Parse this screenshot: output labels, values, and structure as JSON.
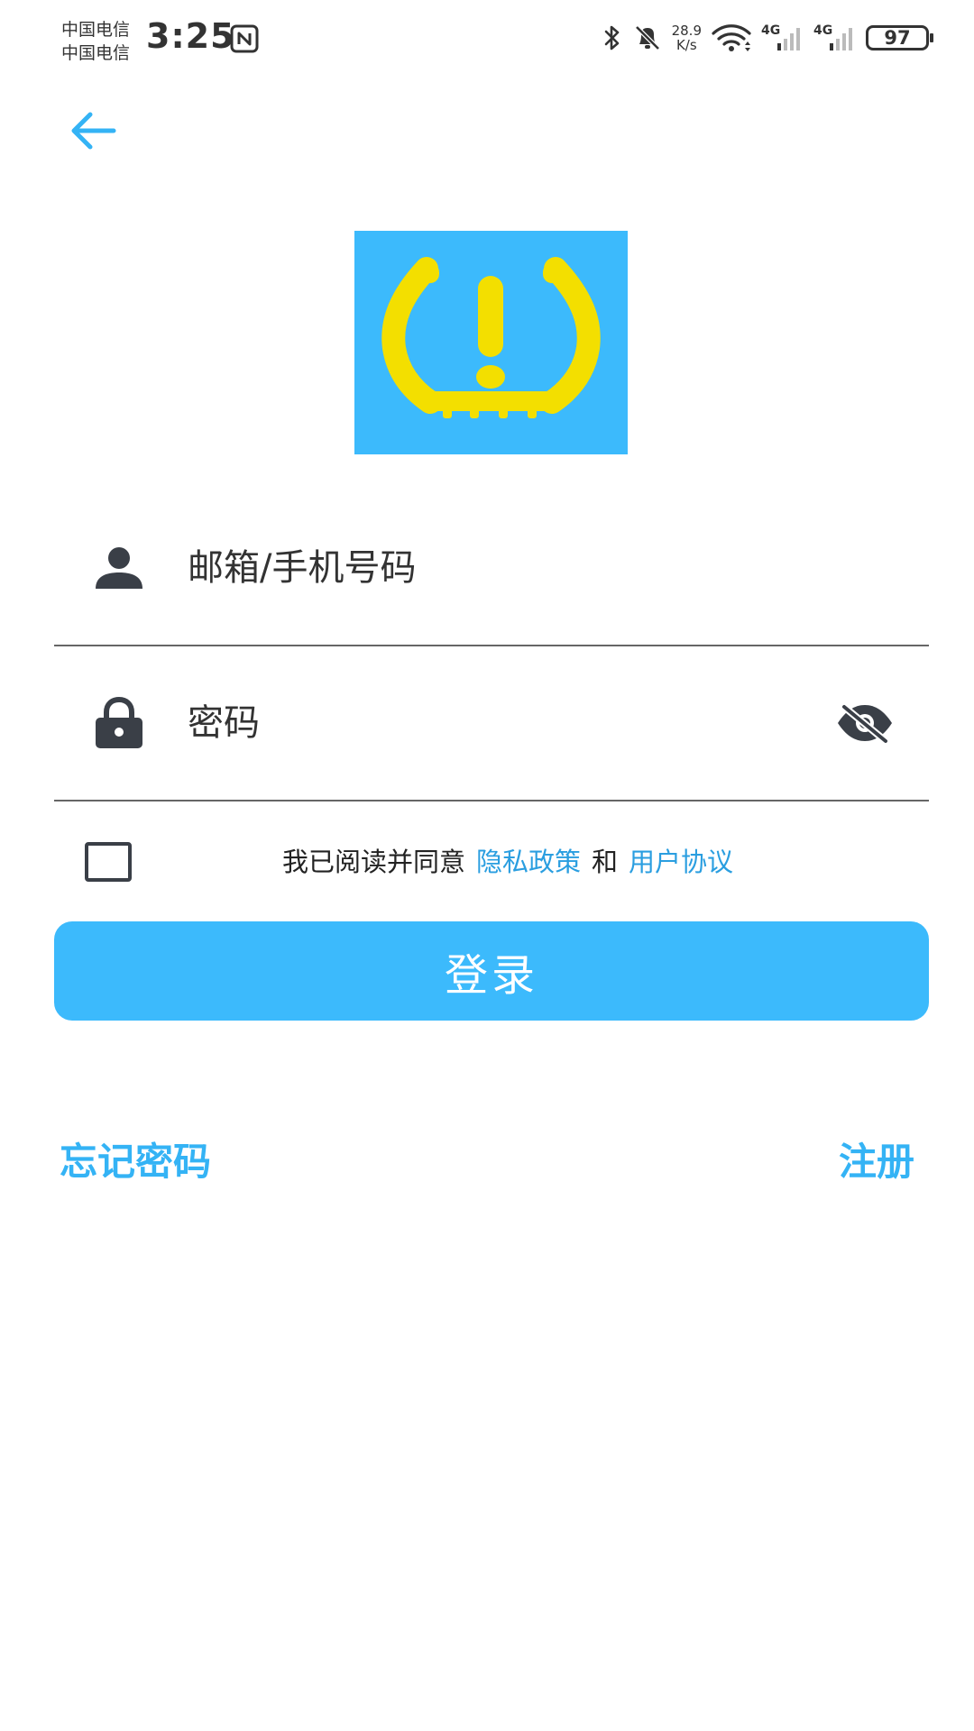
{
  "status_bar": {
    "carrier_1": "中国电信",
    "carrier_2": "中国电信",
    "time": "3:25",
    "net_speed_value": "28.9",
    "net_speed_unit": "K/s",
    "signal_1_label": "4G",
    "signal_2_label": "4G",
    "battery_level": "97",
    "icons": [
      "nfc-icon",
      "bluetooth-icon",
      "bell-muted-icon",
      "wifi-icon",
      "signal-icon",
      "signal-icon",
      "battery-icon"
    ]
  },
  "header": {
    "back_icon": "arrow-left-icon"
  },
  "logo": {
    "icon": "tire-pressure-warning-icon",
    "background_color": "#3cbafc",
    "symbol_color": "#f3df00"
  },
  "form": {
    "account_placeholder": "邮箱/手机号码",
    "account_icon": "person-icon",
    "password_placeholder": "密码",
    "password_icon": "lock-icon",
    "visibility_icon": "eye-off-icon"
  },
  "agreement": {
    "checked": false,
    "lead_text": "我已阅读并同意",
    "privacy_link": "隐私政策",
    "conjunction": "和",
    "terms_link": "用户协议"
  },
  "actions": {
    "login_label": "登录",
    "forgot_password_label": "忘记密码",
    "register_label": "注册"
  },
  "colors": {
    "primary": "#3cbafc",
    "link": "#2a9ee0",
    "accent_text": "#34b3f5"
  }
}
